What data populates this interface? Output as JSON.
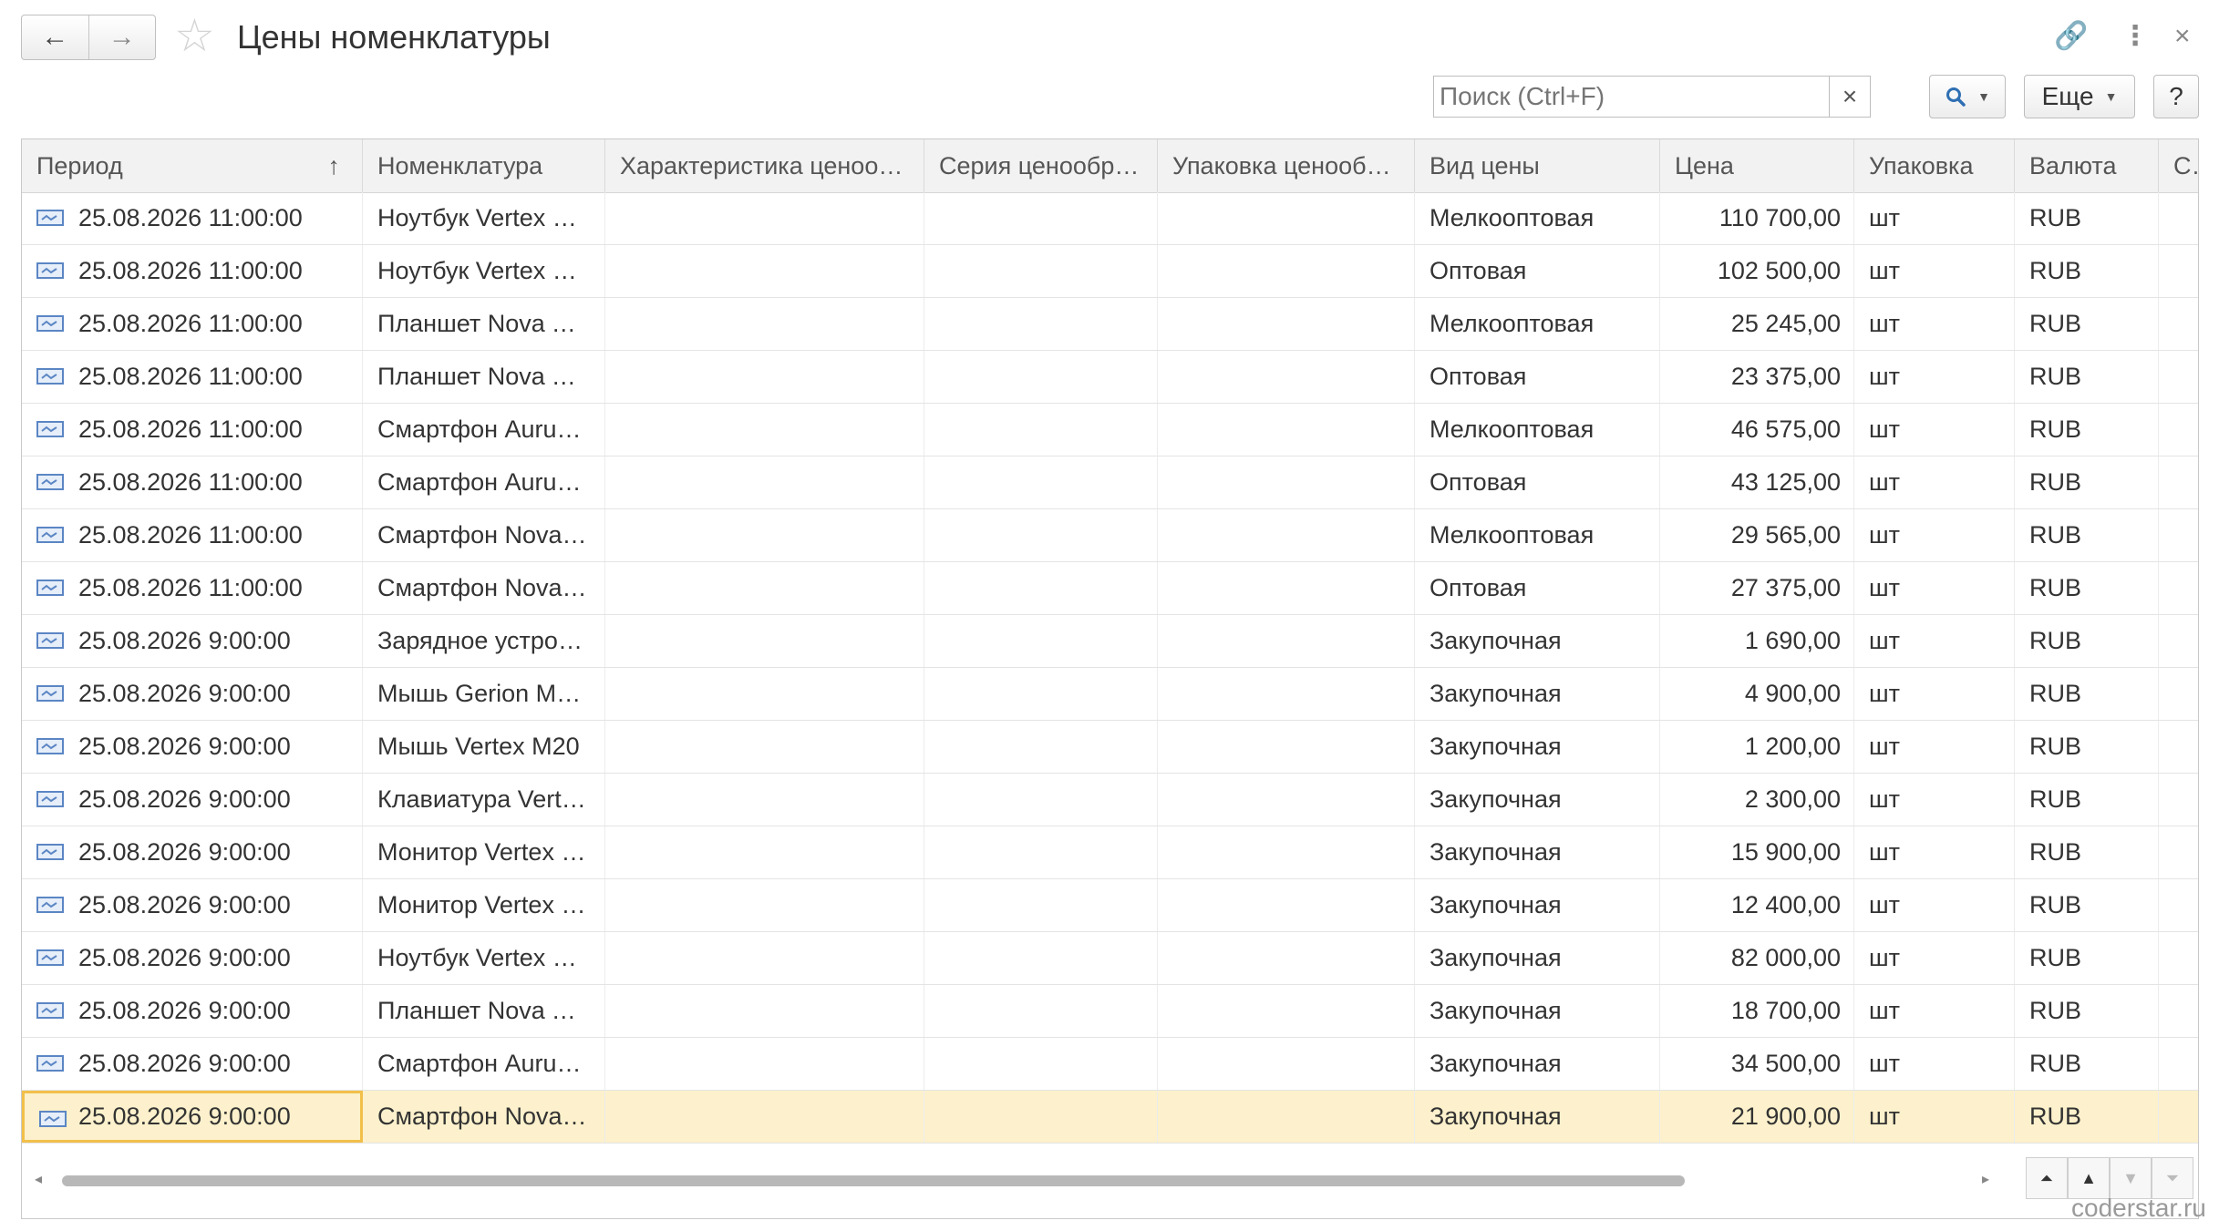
{
  "window": {
    "title": "Цены номенклатуры",
    "back_icon": "←",
    "forward_icon": "→",
    "star_icon": "☆",
    "link_icon": "🔗",
    "more_icon": "⋮",
    "close_icon": "×"
  },
  "toolbar": {
    "search_placeholder": "Поиск (Ctrl+F)",
    "search_clear": "×",
    "search_button_icon": "🔍",
    "more_label": "Еще",
    "help_label": "?"
  },
  "table": {
    "columns": [
      "Период",
      "Номенклатура",
      "Характеристика ценообразования",
      "Серия ценообразования",
      "Упаковка ценообразования",
      "Вид цены",
      "Цена",
      "Упаковка",
      "Валюта",
      "Ста"
    ],
    "sort_indicator": "↑",
    "rows": [
      {
        "period": "25.08.2026 11:00:00",
        "item": "Ноутбук Vertex …",
        "price_type": "Мелкооптовая",
        "price": "110 700,00",
        "pack": "шт",
        "currency": "RUB"
      },
      {
        "period": "25.08.2026 11:00:00",
        "item": "Ноутбук Vertex …",
        "price_type": "Оптовая",
        "price": "102 500,00",
        "pack": "шт",
        "currency": "RUB"
      },
      {
        "period": "25.08.2026 11:00:00",
        "item": "Планшет Nova T…",
        "price_type": "Мелкооптовая",
        "price": "25 245,00",
        "pack": "шт",
        "currency": "RUB"
      },
      {
        "period": "25.08.2026 11:00:00",
        "item": "Планшет Nova T…",
        "price_type": "Оптовая",
        "price": "23 375,00",
        "pack": "шт",
        "currency": "RUB"
      },
      {
        "period": "25.08.2026 11:00:00",
        "item": "Смартфон Auru…",
        "price_type": "Мелкооптовая",
        "price": "46 575,00",
        "pack": "шт",
        "currency": "RUB"
      },
      {
        "period": "25.08.2026 11:00:00",
        "item": "Смартфон Auru…",
        "price_type": "Оптовая",
        "price": "43 125,00",
        "pack": "шт",
        "currency": "RUB"
      },
      {
        "period": "25.08.2026 11:00:00",
        "item": "Смартфон Nova…",
        "price_type": "Мелкооптовая",
        "price": "29 565,00",
        "pack": "шт",
        "currency": "RUB"
      },
      {
        "period": "25.08.2026 11:00:00",
        "item": "Смартфон Nova…",
        "price_type": "Оптовая",
        "price": "27 375,00",
        "pack": "шт",
        "currency": "RUB"
      },
      {
        "period": "25.08.2026 9:00:00",
        "item": "Зарядное устро…",
        "price_type": "Закупочная",
        "price": "1 690,00",
        "pack": "шт",
        "currency": "RUB"
      },
      {
        "period": "25.08.2026 9:00:00",
        "item": "Мышь Gerion M…",
        "price_type": "Закупочная",
        "price": "4 900,00",
        "pack": "шт",
        "currency": "RUB"
      },
      {
        "period": "25.08.2026 9:00:00",
        "item": "Мышь Vertex M20",
        "price_type": "Закупочная",
        "price": "1 200,00",
        "pack": "шт",
        "currency": "RUB"
      },
      {
        "period": "25.08.2026 9:00:00",
        "item": "Клавиатура Vert…",
        "price_type": "Закупочная",
        "price": "2 300,00",
        "pack": "шт",
        "currency": "RUB"
      },
      {
        "period": "25.08.2026 9:00:00",
        "item": "Монитор Vertex …",
        "price_type": "Закупочная",
        "price": "15 900,00",
        "pack": "шт",
        "currency": "RUB"
      },
      {
        "period": "25.08.2026 9:00:00",
        "item": "Монитор Vertex …",
        "price_type": "Закупочная",
        "price": "12 400,00",
        "pack": "шт",
        "currency": "RUB"
      },
      {
        "period": "25.08.2026 9:00:00",
        "item": "Ноутбук Vertex …",
        "price_type": "Закупочная",
        "price": "82 000,00",
        "pack": "шт",
        "currency": "RUB"
      },
      {
        "period": "25.08.2026 9:00:00",
        "item": "Планшет Nova T…",
        "price_type": "Закупочная",
        "price": "18 700,00",
        "pack": "шт",
        "currency": "RUB"
      },
      {
        "period": "25.08.2026 9:00:00",
        "item": "Смартфон Auru…",
        "price_type": "Закупочная",
        "price": "34 500,00",
        "pack": "шт",
        "currency": "RUB"
      },
      {
        "period": "25.08.2026 9:00:00",
        "item": "Смартфон Nova…",
        "price_type": "Закупочная",
        "price": "21 900,00",
        "pack": "шт",
        "currency": "RUB"
      }
    ],
    "selected_row": 17
  },
  "navigation": {
    "scroll_left": "◂",
    "scroll_right": "▸",
    "page_first": "⏶",
    "page_up": "▲",
    "page_down": "▼",
    "page_last": "⏷"
  },
  "watermark": "coderstar.ru",
  "colors": {
    "selected_row": "#fcf1cc",
    "focus_border": "#f2c04a",
    "header_bg": "#f2f2f2",
    "record_icon": "#5b86c4"
  }
}
